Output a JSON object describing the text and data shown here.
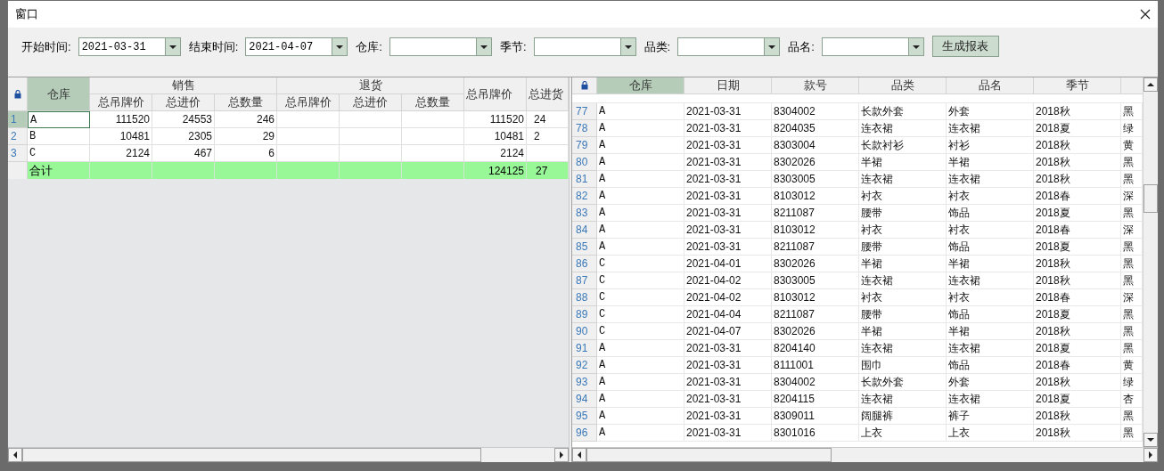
{
  "window": {
    "title": "窗口"
  },
  "filters": [
    {
      "label": "开始时间:",
      "value": "2021-03-31"
    },
    {
      "label": "结束时间:",
      "value": "2021-04-07"
    },
    {
      "label": "仓库:"
    },
    {
      "label": "季节:"
    },
    {
      "label": "品类:"
    },
    {
      "label": "品名:"
    }
  ],
  "generate_button": "生成报表",
  "summary_table": {
    "key_column": "仓库",
    "groups": [
      {
        "label": "销售",
        "columns": [
          "总吊牌价",
          "总进价",
          "总数量"
        ]
      },
      {
        "label": "退货",
        "columns": [
          "总吊牌价",
          "总进价",
          "总数量"
        ]
      }
    ],
    "extra_columns": [
      "总吊牌价",
      "总进货"
    ],
    "rows": [
      {
        "index": "1",
        "selected": true,
        "cells": [
          "A",
          "111520",
          "24553",
          "246",
          null,
          null,
          null,
          "111520",
          "24"
        ]
      },
      {
        "index": "2",
        "selected": false,
        "cells": [
          "B",
          "10481",
          "2305",
          "29",
          null,
          null,
          null,
          "10481",
          "2"
        ]
      },
      {
        "index": "3",
        "selected": false,
        "cells": [
          "C",
          "2124",
          "467",
          "6",
          null,
          null,
          null,
          "2124",
          null
        ]
      }
    ],
    "total": {
      "label": "合计",
      "cells": [
        null,
        null,
        null,
        null,
        null,
        null,
        "124125",
        "27"
      ]
    }
  },
  "detail_table": {
    "columns": [
      "仓库",
      "日期",
      "款号",
      "品类",
      "品名",
      "季节"
    ],
    "rows": [
      {
        "index": "77",
        "cells": [
          "A",
          "2021-03-31",
          "8304002",
          "长款外套",
          "外套",
          "2018秋",
          "黑"
        ]
      },
      {
        "index": "78",
        "cells": [
          "A",
          "2021-03-31",
          "8204035",
          "连衣裙",
          "连衣裙",
          "2018夏",
          "绿"
        ]
      },
      {
        "index": "79",
        "cells": [
          "A",
          "2021-03-31",
          "8303004",
          "长款衬衫",
          "衬衫",
          "2018秋",
          "黄"
        ]
      },
      {
        "index": "80",
        "cells": [
          "A",
          "2021-03-31",
          "8302026",
          "半裙",
          "半裙",
          "2018秋",
          "黑"
        ]
      },
      {
        "index": "81",
        "cells": [
          "A",
          "2021-03-31",
          "8303005",
          "连衣裙",
          "连衣裙",
          "2018秋",
          "黑"
        ]
      },
      {
        "index": "82",
        "cells": [
          "A",
          "2021-03-31",
          "8103012",
          "衬衣",
          "衬衣",
          "2018春",
          "深"
        ]
      },
      {
        "index": "83",
        "cells": [
          "A",
          "2021-03-31",
          "8211087",
          "腰带",
          "饰品",
          "2018夏",
          "黑"
        ]
      },
      {
        "index": "84",
        "cells": [
          "A",
          "2021-03-31",
          "8103012",
          "衬衣",
          "衬衣",
          "2018春",
          "深"
        ]
      },
      {
        "index": "85",
        "cells": [
          "A",
          "2021-03-31",
          "8211087",
          "腰带",
          "饰品",
          "2018夏",
          "黑"
        ]
      },
      {
        "index": "86",
        "cells": [
          "C",
          "2021-04-01",
          "8302026",
          "半裙",
          "半裙",
          "2018秋",
          "黑"
        ]
      },
      {
        "index": "87",
        "cells": [
          "C",
          "2021-04-02",
          "8303005",
          "连衣裙",
          "连衣裙",
          "2018秋",
          "黑"
        ]
      },
      {
        "index": "88",
        "cells": [
          "C",
          "2021-04-02",
          "8103012",
          "衬衣",
          "衬衣",
          "2018春",
          "深"
        ]
      },
      {
        "index": "89",
        "cells": [
          "C",
          "2021-04-04",
          "8211087",
          "腰带",
          "饰品",
          "2018夏",
          "黑"
        ]
      },
      {
        "index": "90",
        "cells": [
          "C",
          "2021-04-07",
          "8302026",
          "半裙",
          "半裙",
          "2018秋",
          "黑"
        ]
      },
      {
        "index": "91",
        "cells": [
          "A",
          "2021-03-31",
          "8204140",
          "连衣裙",
          "连衣裙",
          "2018夏",
          "黑"
        ]
      },
      {
        "index": "92",
        "cells": [
          "A",
          "2021-03-31",
          "8111001",
          "围巾",
          "饰品",
          "2018春",
          "黄"
        ]
      },
      {
        "index": "93",
        "cells": [
          "A",
          "2021-03-31",
          "8304002",
          "长款外套",
          "外套",
          "2018秋",
          "绿"
        ]
      },
      {
        "index": "94",
        "cells": [
          "A",
          "2021-03-31",
          "8204115",
          "连衣裙",
          "连衣裙",
          "2018夏",
          "杏"
        ]
      },
      {
        "index": "95",
        "cells": [
          "A",
          "2021-03-31",
          "8309011",
          "阔腿裤",
          "裤子",
          "2018秋",
          "黑"
        ]
      },
      {
        "index": "96",
        "cells": [
          "A",
          "2021-03-31",
          "8301016",
          "上衣",
          "上衣",
          "2018秋",
          "黑"
        ]
      }
    ]
  }
}
